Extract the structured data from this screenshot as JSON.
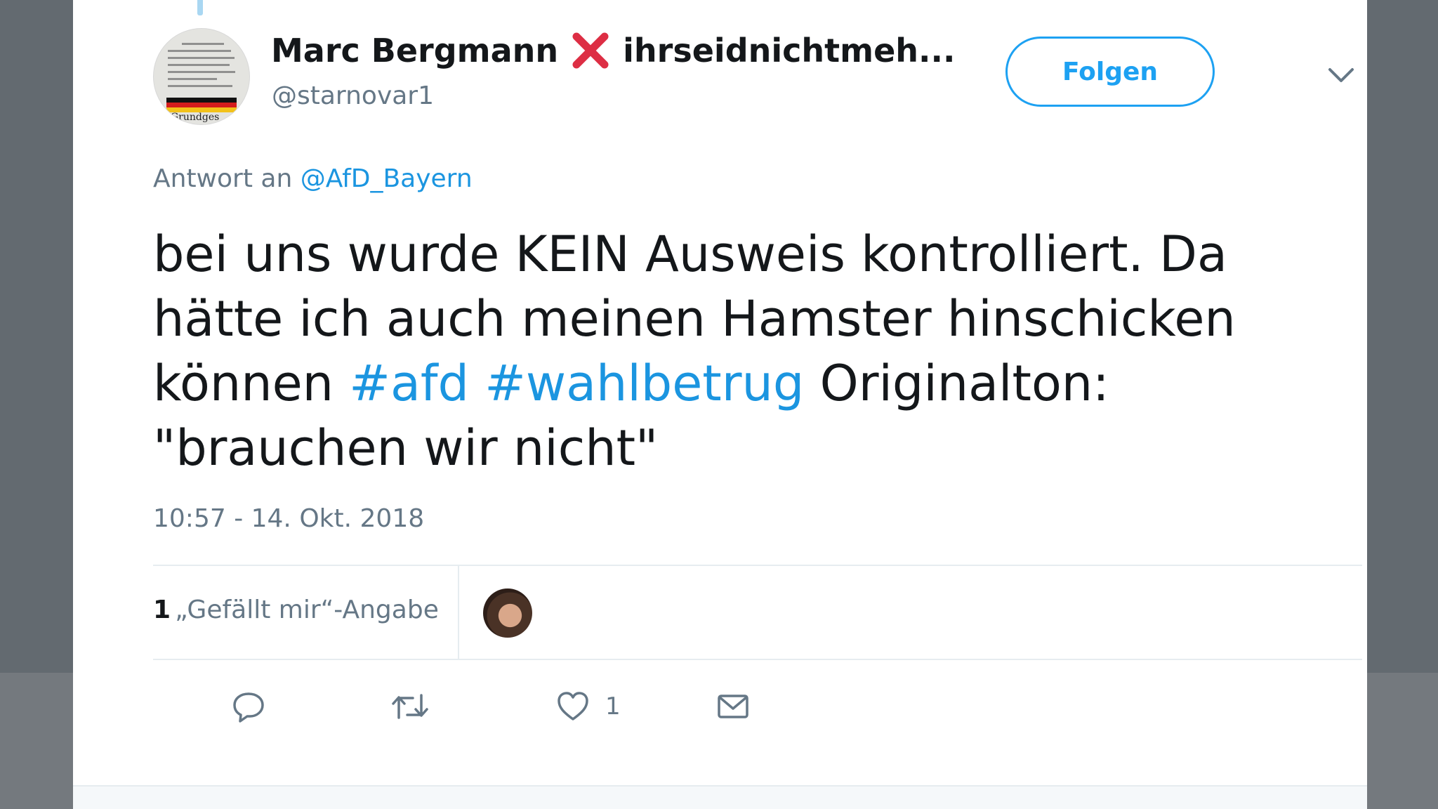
{
  "colors": {
    "brand": "#1da1f2",
    "link": "#1b95e0",
    "text_primary": "#14171a",
    "text_secondary": "#657786",
    "cross_red": "#dd2e44",
    "backdrop": "#636a70"
  },
  "author": {
    "display_name": "Marc Bergmann",
    "name_emoji": "cross-mark-icon",
    "name_suffix": "ihrseidnichtmeh...",
    "handle": "@starnovar1",
    "avatar_caption": "Grundges"
  },
  "follow_button": {
    "label": "Folgen"
  },
  "more_menu": {
    "icon": "chevron-down-icon"
  },
  "reply": {
    "prefix": "Antwort an",
    "mention": "@AfD_Bayern"
  },
  "tweet": {
    "text_part1": "bei uns wurde KEIN Ausweis kontrolliert. Da hätte ich auch meinen Hamster hinschicken können",
    "hashtags": [
      "#afd",
      "#wahlbetrug"
    ],
    "text_part2": "Originalton: \"brauchen wir nicht\"",
    "timestamp": "10:57 - 14. Okt. 2018"
  },
  "stats": {
    "likes_count": "1",
    "likes_label": "„Gefällt mir“-Angabe"
  },
  "actions": [
    {
      "icon": "reply-icon",
      "count": ""
    },
    {
      "icon": "retweet-icon",
      "count": ""
    },
    {
      "icon": "heart-icon",
      "count": "1"
    },
    {
      "icon": "envelope-icon",
      "count": ""
    }
  ]
}
